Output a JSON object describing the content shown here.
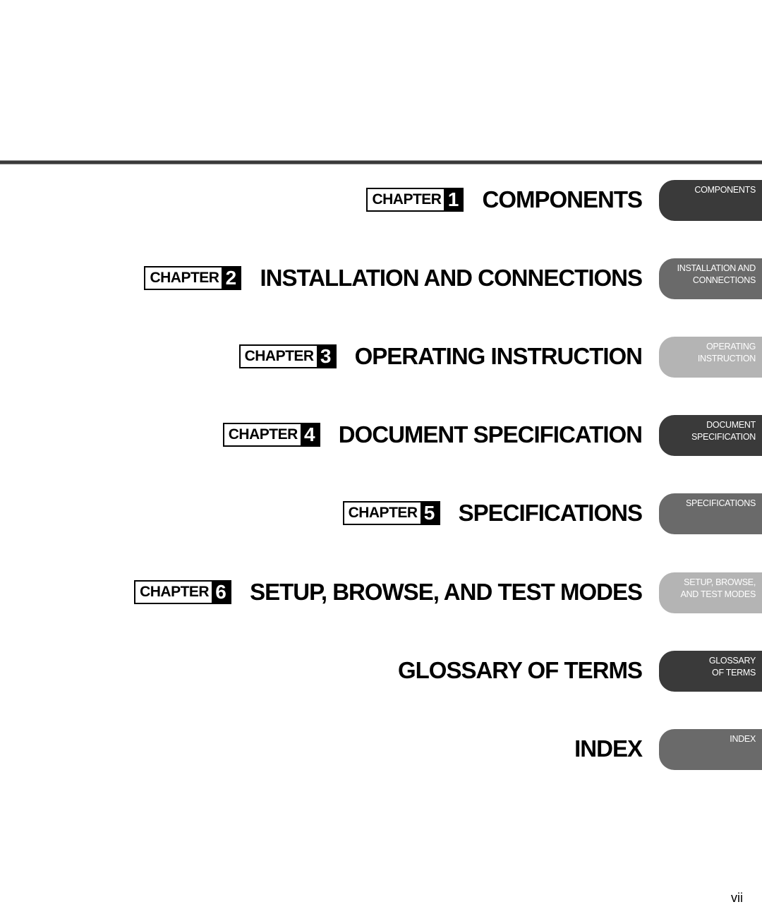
{
  "chapters": [
    {
      "badge_word": "CHAPTER",
      "number": "1",
      "title": "COMPONENTS",
      "tab_lines": [
        "COMPONENTS"
      ],
      "tab_color": "#3a3a3a"
    },
    {
      "badge_word": "CHAPTER",
      "number": "2",
      "title": "INSTALLATION AND CONNECTIONS",
      "tab_lines": [
        "INSTALLATION AND",
        "CONNECTIONS"
      ],
      "tab_color": "#6a6a6a"
    },
    {
      "badge_word": "CHAPTER",
      "number": "3",
      "title": "OPERATING INSTRUCTION",
      "tab_lines": [
        "OPERATING",
        "INSTRUCTION"
      ],
      "tab_color": "#b4b4b4"
    },
    {
      "badge_word": "CHAPTER",
      "number": "4",
      "title": "DOCUMENT SPECIFICATION",
      "tab_lines": [
        "DOCUMENT",
        "SPECIFICATION"
      ],
      "tab_color": "#3a3a3a"
    },
    {
      "badge_word": "CHAPTER",
      "number": "5",
      "title": "SPECIFICATIONS",
      "tab_lines": [
        "SPECIFICATIONS"
      ],
      "tab_color": "#6a6a6a"
    },
    {
      "badge_word": "CHAPTER",
      "number": "6",
      "title": "SETUP, BROWSE, AND TEST MODES",
      "tab_lines": [
        "SETUP, BROWSE,",
        "AND TEST MODES"
      ],
      "tab_color": "#b4b4b4"
    }
  ],
  "appendices": [
    {
      "title": "GLOSSARY OF TERMS",
      "tab_lines": [
        "GLOSSARY",
        "OF TERMS"
      ],
      "tab_color": "#3a3a3a"
    },
    {
      "title": "INDEX",
      "tab_lines": [
        "INDEX"
      ],
      "tab_color": "#6a6a6a"
    }
  ],
  "page_number": "vii"
}
